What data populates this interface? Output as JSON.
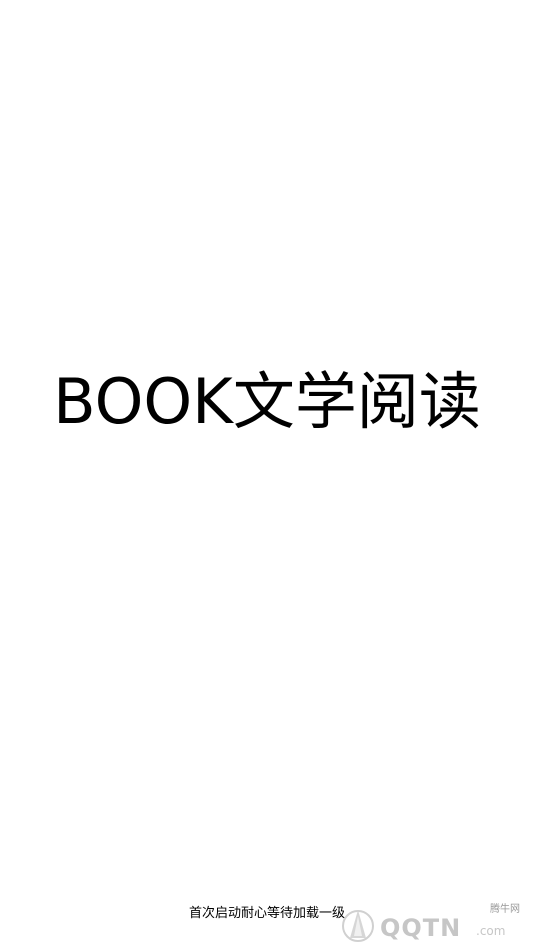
{
  "splash": {
    "title": "BOOK文学阅读",
    "loading_hint": "首次启动耐心等待加载一级"
  },
  "watermark": {
    "site_name": "腾牛网",
    "brand": "QQTN",
    "domain_suffix": ".com",
    "logo_icon": "triangle-logo-icon"
  },
  "colors": {
    "background": "#ffffff",
    "text": "#000000",
    "watermark": "#bdbdbd"
  }
}
